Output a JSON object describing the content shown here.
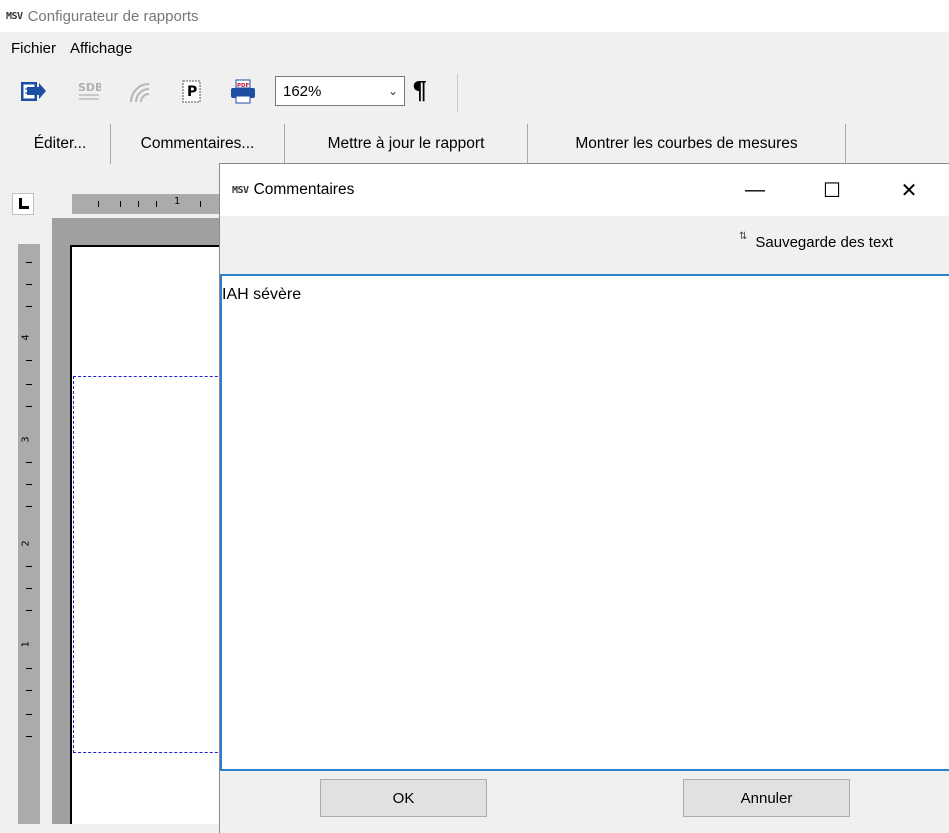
{
  "app": {
    "logo": "MSV",
    "title": "Configurateur de rapports"
  },
  "menu": {
    "items": [
      "Fichier",
      "Affichage"
    ]
  },
  "toolbar": {
    "icons": [
      "export-icon",
      "sdb-icon",
      "wireless-icon",
      "page-p-icon",
      "print-pdf-icon"
    ],
    "sdb_label": "SDB",
    "pdf_label": "PDF",
    "p_label": "P",
    "zoom_value": "162%",
    "pilcrow": "¶"
  },
  "textbar": {
    "buttons": [
      "Éditer...",
      "Commentaires...",
      "Mettre à jour le rapport",
      "Montrer les courbes de mesures"
    ]
  },
  "ruler": {
    "h_labels": [
      "1"
    ],
    "v_labels": [
      "4",
      "3",
      "2",
      "1"
    ]
  },
  "dialog": {
    "logo": "MSV",
    "title": "Commentaires",
    "minimize": "—",
    "maximize": "☐",
    "close": "✕",
    "save_label": "Sauvegarde des text",
    "comment_text": "IAH sévère",
    "ok_label": "OK",
    "cancel_label": "Annuler"
  },
  "colors": {
    "focus_border": "#2f7fd1",
    "margin_dash": "#1f1fd0",
    "pdf_red": "#c8102e",
    "print_blue": "#1d4ea3"
  }
}
